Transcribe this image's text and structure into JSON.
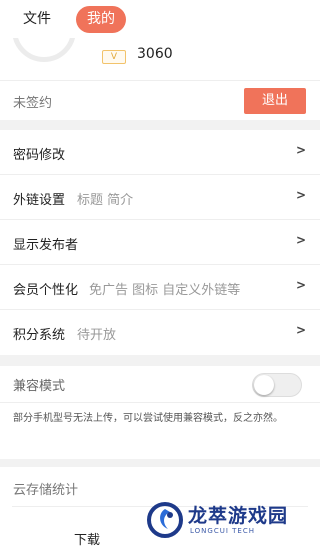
{
  "tabs": {
    "files": "文件",
    "mine": "我的"
  },
  "profile": {
    "vip_badge": "V",
    "points": "3060"
  },
  "sign": {
    "status": "未签约",
    "logout": "退出"
  },
  "menu": [
    {
      "label": "密码修改",
      "sub": "",
      "chevron": ">"
    },
    {
      "label": "外链设置",
      "sub": "标题 简介",
      "chevron": ">"
    },
    {
      "label": "显示发布者",
      "sub": "",
      "chevron": ">"
    },
    {
      "label": "会员个性化",
      "sub": "免广告 图标 自定义外链等",
      "chevron": ">"
    },
    {
      "label": "积分系统",
      "sub": "待开放",
      "chevron": ">"
    }
  ],
  "compat": {
    "label": "兼容模式",
    "enabled": false,
    "description": "部分手机型号无法上传，可以尝试使用兼容模式，反之亦然。"
  },
  "storage": {
    "title": "云存储统计",
    "download_label": "下载"
  },
  "watermark": {
    "name": "龙萃游戏园",
    "sub": "LONGCUI TECH"
  },
  "colors": {
    "accent": "#f0735a",
    "vip": "#e2a93a",
    "watermark": "#1e3a8a"
  }
}
